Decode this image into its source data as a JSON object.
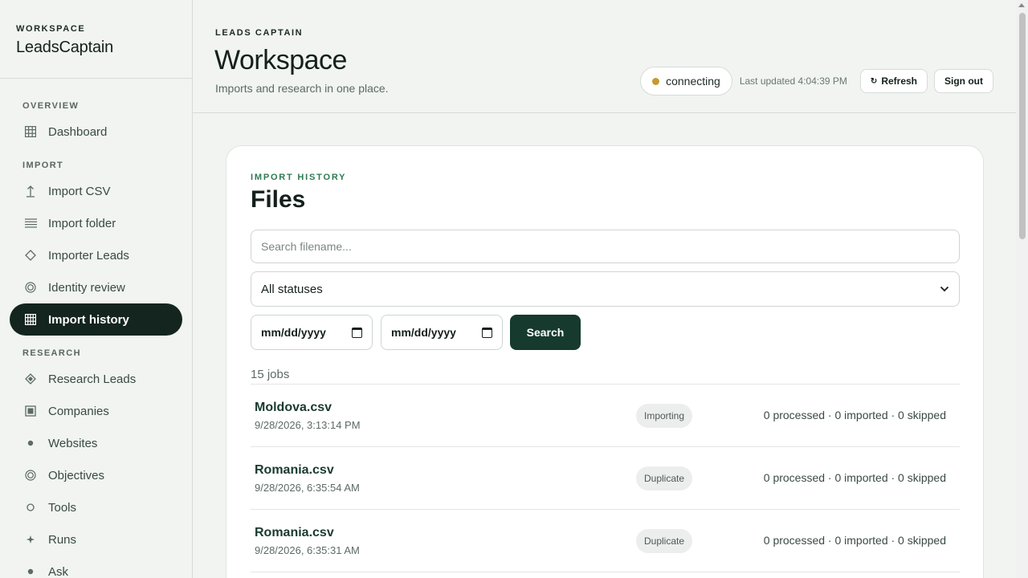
{
  "workspace": {
    "kicker": "WORKSPACE",
    "name": "LeadsCaptain"
  },
  "nav": {
    "overview_label": "OVERVIEW",
    "overview_items": [
      {
        "label": "Dashboard",
        "icon": "grid-icon"
      }
    ],
    "import_label": "IMPORT",
    "import_items": [
      {
        "label": "Import CSV",
        "icon": "upload-arrow-icon"
      },
      {
        "label": "Import folder",
        "icon": "lines-icon"
      },
      {
        "label": "Importer Leads",
        "icon": "diamond-outline-icon"
      },
      {
        "label": "Identity review",
        "icon": "ring-icon"
      },
      {
        "label": "Import history",
        "icon": "grid-icon",
        "active": true
      }
    ],
    "research_label": "RESEARCH",
    "research_items": [
      {
        "label": "Research Leads",
        "icon": "diamond-filled-icon"
      },
      {
        "label": "Companies",
        "icon": "square-icon"
      },
      {
        "label": "Websites",
        "icon": "dot-icon"
      },
      {
        "label": "Objectives",
        "icon": "target-icon"
      },
      {
        "label": "Tools",
        "icon": "circle-small-icon"
      },
      {
        "label": "Runs",
        "icon": "sparkle-icon"
      },
      {
        "label": "Ask",
        "icon": "dot-icon"
      }
    ]
  },
  "header": {
    "kicker": "LEADS CAPTAIN",
    "title": "Workspace",
    "subtitle": "Imports and research in one place.",
    "status": "connecting",
    "status_color": "#c59a2f",
    "last_updated": "Last updated 4:04:39 PM",
    "refresh_label": "Refresh",
    "signout_label": "Sign out"
  },
  "history": {
    "kicker": "IMPORT HISTORY",
    "title": "Files",
    "search_placeholder": "Search filename...",
    "status_filter": "All statuses",
    "date_from": "mm/dd/yyyy",
    "date_to": "mm/dd/yyyy",
    "search_label": "Search",
    "count": "15 jobs",
    "rows": [
      {
        "name": "Moldova.csv",
        "date": "9/28/2026, 3:13:14 PM",
        "status": "Importing",
        "stats": "0 processed · 0 imported · 0 skipped"
      },
      {
        "name": "Romania.csv",
        "date": "9/28/2026, 6:35:54 AM",
        "status": "Duplicate",
        "stats": "0 processed · 0 imported · 0 skipped"
      },
      {
        "name": "Romania.csv",
        "date": "9/28/2026, 6:35:31 AM",
        "status": "Duplicate",
        "stats": "0 processed · 0 imported · 0 skipped"
      }
    ]
  },
  "colors": {
    "accent": "#163a2e",
    "active_nav": "#13251e",
    "kicker_green": "#2e7a55"
  }
}
